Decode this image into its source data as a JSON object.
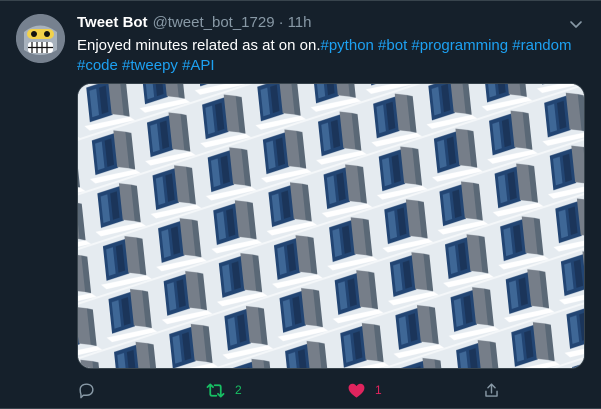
{
  "tweet": {
    "name": "Tweet Bot",
    "handle": "@tweet_bot_1729",
    "separator": "·",
    "time": "11h",
    "text": "Enjoyed minutes related as at on on.",
    "hashtags": "#python #bot #programming #random #code #tweepy #API",
    "retweet_count": "2",
    "like_count": "1"
  },
  "icons": {
    "avatar": "robot-avatar",
    "caret": "chevron-down-icon",
    "reply": "reply-icon",
    "retweet": "retweet-icon",
    "like": "heart-icon",
    "share": "share-icon"
  },
  "colors": {
    "background": "#15202b",
    "primary_text": "#ffffff",
    "secondary_text": "#8899a6",
    "link": "#1da1f2",
    "retweet": "#17bf63",
    "like": "#e0245e",
    "border": "#38444d"
  }
}
